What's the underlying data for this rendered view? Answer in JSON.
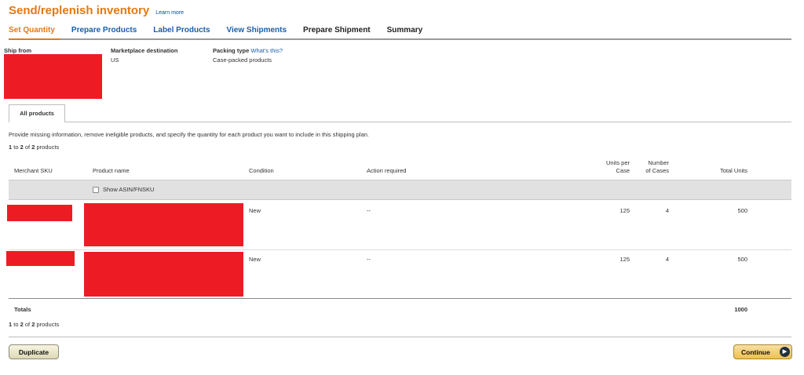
{
  "header": {
    "title": "Send/replenish inventory",
    "learn_more": "Learn more"
  },
  "steps": [
    {
      "label": "Set Quantity"
    },
    {
      "label": "Prepare Products"
    },
    {
      "label": "Label Products"
    },
    {
      "label": "View Shipments"
    },
    {
      "label": "Prepare Shipment"
    },
    {
      "label": "Summary"
    }
  ],
  "info": {
    "ship_from_label": "Ship from",
    "marketplace_label": "Marketplace destination",
    "marketplace_value": "US",
    "packing_label": "Packing type",
    "packing_link": "What's this?",
    "packing_value": "Case-packed products"
  },
  "tabs": {
    "all_products": "All products"
  },
  "instructions": "Provide missing information, remove ineligible products, and specify the quantity for each product you want to include in this shipping plan.",
  "pagination": {
    "from": "1",
    "to_word": "to",
    "to": "2",
    "of_word": "of",
    "total": "2",
    "noun": "products"
  },
  "table": {
    "columns": {
      "sku": "Merchant SKU",
      "product_name": "Product name",
      "condition": "Condition",
      "action": "Action required",
      "units_per_case_1": "Units per",
      "units_per_case_2": "Case",
      "num_cases_1": "Number",
      "num_cases_2": "of Cases",
      "total_units": "Total Units"
    },
    "show_asin": "Show ASIN/FNSKU",
    "rows": [
      {
        "condition": "New",
        "action": "--",
        "units_per_case": "125",
        "num_cases": "4",
        "total_units": "500"
      },
      {
        "condition": "New",
        "action": "--",
        "units_per_case": "125",
        "num_cases": "4",
        "total_units": "500"
      }
    ],
    "totals_label": "Totals",
    "totals_value": "1000"
  },
  "buttons": {
    "duplicate": "Duplicate",
    "continue": "Continue"
  },
  "colors": {
    "title": "#e47911",
    "link": "#1a5ea8",
    "redaction": "#ed1c24",
    "continue_button": "#f0c14b"
  }
}
